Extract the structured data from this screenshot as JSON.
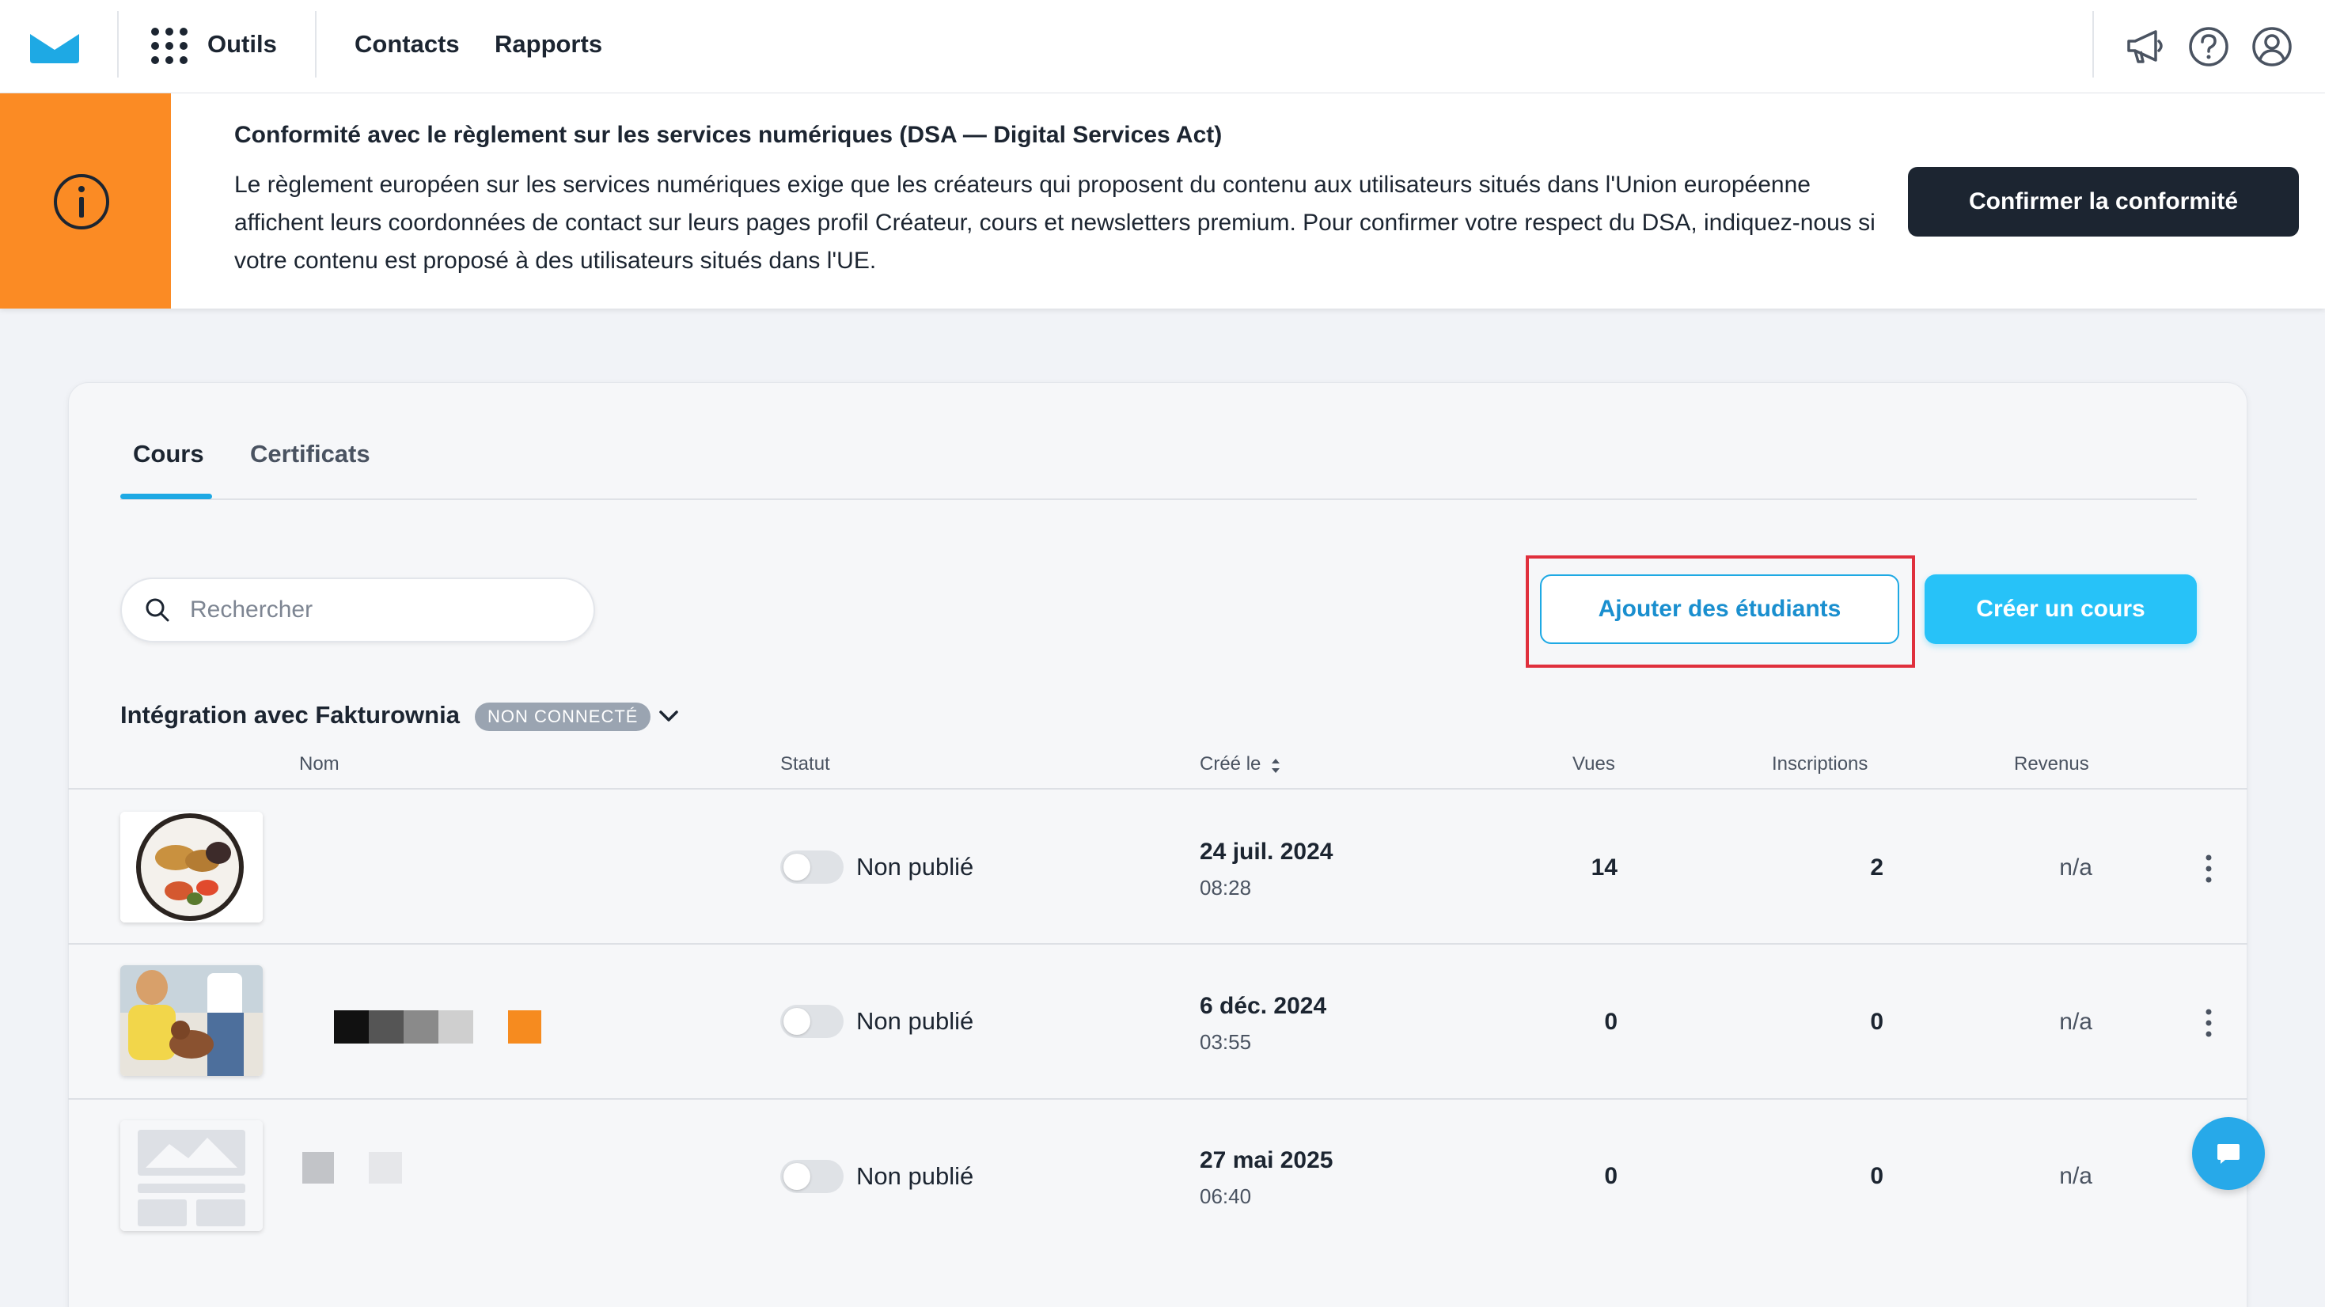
{
  "topbar": {
    "tools_label": "Outils",
    "contacts_label": "Contacts",
    "reports_label": "Rapports",
    "icons": [
      "envelope-logo-icon",
      "apps-grid-icon",
      "megaphone-icon",
      "help-icon",
      "account-icon"
    ]
  },
  "banner": {
    "title": "Conformité avec le règlement sur les services numériques (DSA — Digital Services Act)",
    "body": "Le règlement européen sur les services numériques exige que les créateurs qui proposent du contenu aux utilisateurs situés dans l'Union européenne affichent leurs coordonnées de contact sur leurs pages profil Créateur, cours et newsletters premium. Pour confirmer votre respect du DSA, indiquez-nous si votre contenu est proposé à des utilisateurs situés dans l'UE.",
    "confirm_button": "Confirmer la conformité",
    "accent_color": "#fb8b24"
  },
  "tabs": [
    {
      "label": "Cours",
      "active": true
    },
    {
      "label": "Certificats",
      "active": false
    }
  ],
  "search": {
    "placeholder": "Rechercher",
    "value": ""
  },
  "actions": {
    "add_students": "Ajouter des étudiants",
    "create_course": "Créer un cours",
    "primary_color": "#27c2f8"
  },
  "integration": {
    "label": "Intégration avec Fakturownia",
    "badge": "NON CONNECTÉ"
  },
  "table": {
    "columns": {
      "name": "Nom",
      "status": "Statut",
      "created": "Créé le",
      "views": "Vues",
      "signups": "Inscriptions",
      "revenue": "Revenus"
    },
    "rows": [
      {
        "status": "Non publié",
        "date": "24 juil. 2024",
        "time": "08:28",
        "views": "14",
        "signups": "2",
        "revenue": "n/a"
      },
      {
        "status": "Non publié",
        "date": "6 déc. 2024",
        "time": "03:55",
        "views": "0",
        "signups": "0",
        "revenue": "n/a"
      },
      {
        "status": "Non publié",
        "date": "27 mai 2025",
        "time": "06:40",
        "views": "0",
        "signups": "0",
        "revenue": "n/a"
      }
    ]
  }
}
